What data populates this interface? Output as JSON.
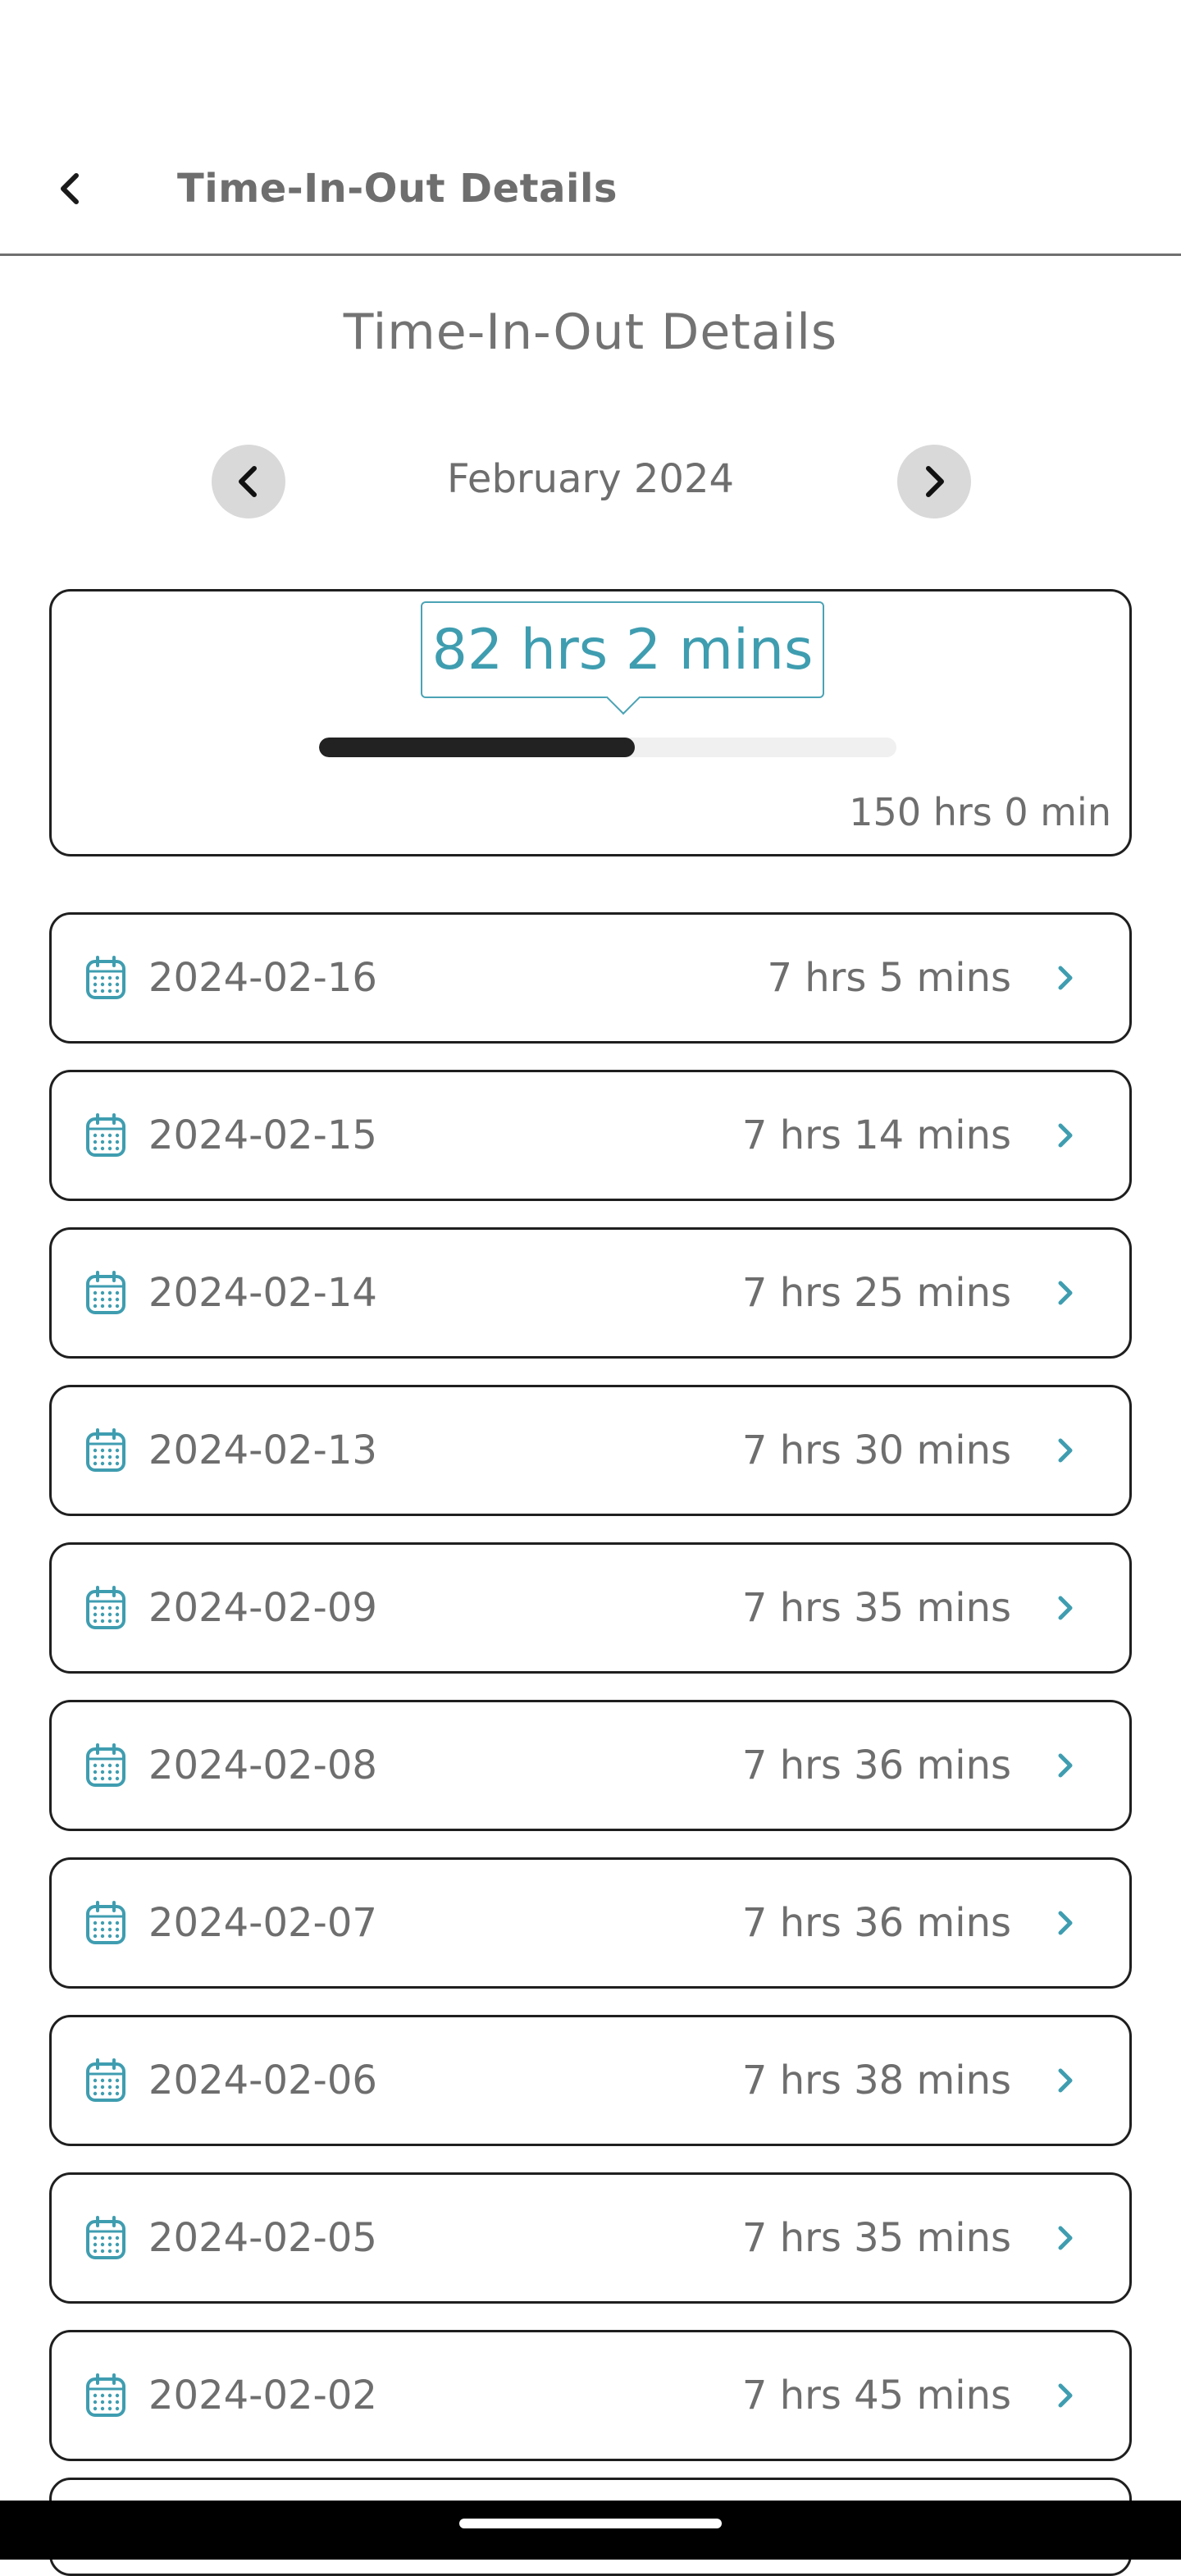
{
  "header": {
    "title": "Time-In-Out Details"
  },
  "page": {
    "heading": "Time-In-Out Details"
  },
  "month_nav": {
    "label": "February 2024"
  },
  "summary": {
    "worked": "82 hrs 2 mins",
    "total": "150 hrs 0 min",
    "progress_fraction": 0.547
  },
  "colors": {
    "accent": "#3f9db0",
    "border": "#1f1f1f",
    "progress": "#222222",
    "nav_button": "#d9d9d9"
  },
  "records": [
    {
      "date": "2024-02-16",
      "duration": "7 hrs 5 mins"
    },
    {
      "date": "2024-02-15",
      "duration": "7 hrs 14 mins"
    },
    {
      "date": "2024-02-14",
      "duration": "7 hrs 25 mins"
    },
    {
      "date": "2024-02-13",
      "duration": "7 hrs 30 mins"
    },
    {
      "date": "2024-02-09",
      "duration": "7 hrs 35 mins"
    },
    {
      "date": "2024-02-08",
      "duration": "7 hrs 36 mins"
    },
    {
      "date": "2024-02-07",
      "duration": "7 hrs 36 mins"
    },
    {
      "date": "2024-02-06",
      "duration": "7 hrs 38 mins"
    },
    {
      "date": "2024-02-05",
      "duration": "7 hrs 35 mins"
    },
    {
      "date": "2024-02-02",
      "duration": "7 hrs 45 mins"
    }
  ]
}
